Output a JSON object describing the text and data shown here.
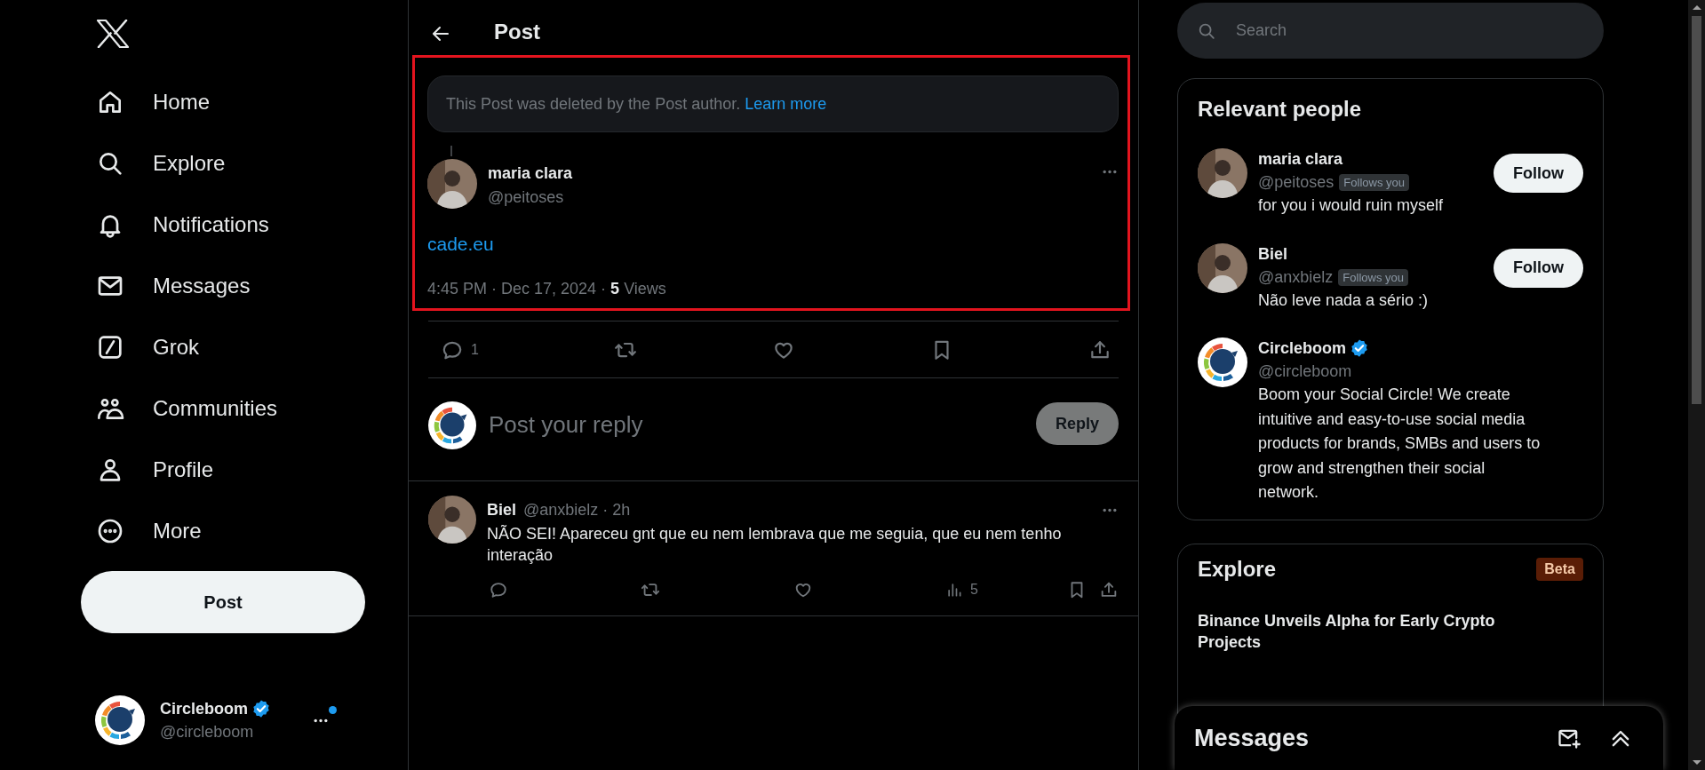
{
  "sidebar": {
    "items": [
      {
        "label": "Home"
      },
      {
        "label": "Explore"
      },
      {
        "label": "Notifications"
      },
      {
        "label": "Messages"
      },
      {
        "label": "Grok"
      },
      {
        "label": "Communities"
      },
      {
        "label": "Profile"
      },
      {
        "label": "More"
      }
    ],
    "post_button": "Post",
    "account": {
      "name": "Circleboom",
      "handle": "@circleboom",
      "verified": true,
      "has_notification": true
    }
  },
  "header": {
    "title": "Post"
  },
  "post": {
    "highlighted": true,
    "notice": "This Post was deleted by the Post author.",
    "notice_link": "Learn more",
    "author": "maria clara",
    "handle": "@peitoses",
    "avatar": {
      "kind": "photo"
    },
    "text": "cade.eu",
    "meta": "4:45 PM · Dec 17, 2024 · **5** Views",
    "reply_count": "1"
  },
  "composer": {
    "placeholder": "Post your reply",
    "button": "Reply",
    "disabled": true
  },
  "replies": [
    {
      "name": "Biel",
      "meta": "@anxbielz · 2h",
      "avatar": {
        "kind": "photo"
      },
      "text": "NÃO SEI! Apareceu gnt que eu nem lembrava que me seguia, que eu nem tenho interação",
      "views": "5"
    }
  ],
  "search": {
    "placeholder": "Search"
  },
  "relevant_people": {
    "title": "Relevant people",
    "people": [
      {
        "name": "maria clara",
        "handle": "@peitoses",
        "avatar": {
          "kind": "photo"
        },
        "verified": false,
        "badge": "Follows you",
        "bio": "for you i would ruin myself",
        "button": "Follow"
      },
      {
        "name": "Biel",
        "handle": "@anxbielz",
        "avatar": {
          "kind": "photo"
        },
        "verified": false,
        "badge": "Follows you",
        "bio": "Não leve nada a sério :)",
        "button": "Follow"
      },
      {
        "name": "Circleboom",
        "handle": "@circleboom",
        "avatar": {
          "kind": "logo"
        },
        "verified": true,
        "bio": "Boom your Social Circle! We create intuitive and easy-to-use social media products for brands, SMBs and users to grow and strengthen their social network."
      }
    ]
  },
  "explore": {
    "title": "Explore",
    "badge": "Beta",
    "items": [
      {
        "headline": "Binance Unveils Alpha for Early Crypto Projects"
      }
    ]
  },
  "messages_drawer": {
    "title": "Messages"
  }
}
